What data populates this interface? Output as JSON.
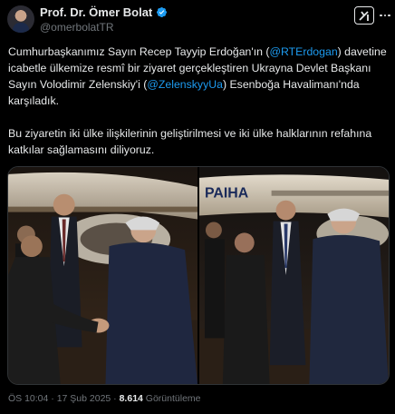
{
  "author": {
    "display_name": "Prof. Dr. Ömer Bolat",
    "handle": "@omerbolatTR",
    "verified_icon": "verified-badge-icon",
    "verified_color": "#1d9bf0"
  },
  "actions": {
    "grok_icon": "grok-icon",
    "more_icon": "more-dots-icon"
  },
  "tweet": {
    "p1_a": "Cumhurbaşkanımız Sayın Recep Tayyip Erdoğan'ın (",
    "mention1": "@RTErdogan",
    "p1_b": ") davetine icabetle ülkemize resmî bir ziyaret gerçekleştiren Ukrayna Devlet Başkanı Sayın Volodimir Zelenskiy'i (",
    "mention2": "@ZelenskyyUa",
    "p1_c": ") Esenboğa Havalimanı'nda karşıladık.",
    "p2": "Bu ziyaretin iki ülke ilişkilerinin geliştirilmesi ve iki ülke halklarının refahına katkılar sağlamasını diliyoruz."
  },
  "media": {
    "photo1_label": "",
    "photo2_label": "",
    "plane_text": "PAIHA"
  },
  "meta": {
    "timestamp": "ÖS 10:04 · 17 Şub 2025 · ",
    "views_count": "8.614",
    "views_label": " Görüntüleme"
  },
  "colors": {
    "background": "#000000",
    "text": "#e7e9ea",
    "secondary": "#71767b",
    "link": "#1d9bf0",
    "border": "#2f3336"
  }
}
